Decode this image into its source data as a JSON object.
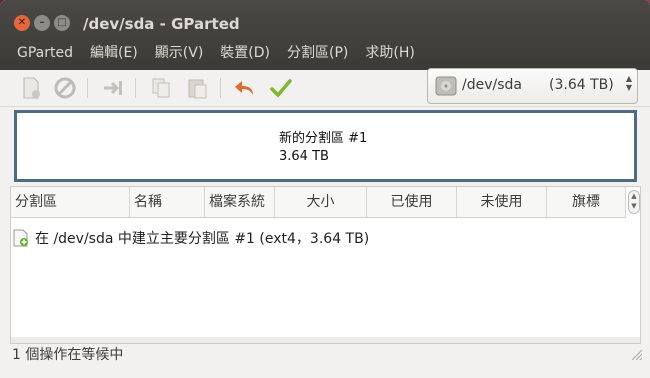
{
  "window": {
    "title": "/dev/sda - GParted"
  },
  "menu": [
    "GParted",
    "編輯(E)",
    "顯示(V)",
    "裝置(D)",
    "分割區(P)",
    "求助(H)"
  ],
  "toolbar": {
    "icons": [
      "new-partition-icon",
      "delete-icon",
      "resize-move-icon",
      "copy-icon",
      "paste-icon",
      "undo-icon",
      "apply-icon"
    ],
    "device_path": "/dev/sda",
    "device_size": "(3.64 TB)"
  },
  "map": {
    "label": "新的分割區 #1",
    "size": "3.64 TB"
  },
  "table": {
    "columns": [
      "分割區",
      "名稱",
      "檔案系統",
      "大小",
      "已使用",
      "未使用",
      "旗標"
    ]
  },
  "operations": [
    {
      "text": "在 /dev/sda 中建立主要分割區 #1 (ext4，3.64 TB)"
    }
  ],
  "status": "1 個操作在等候中",
  "colors": {
    "titlebar": "#3b3a36",
    "close": "#e4683e",
    "map_border": "#4f6a83",
    "apply": "#7fb82e",
    "undo": "#e06b2a"
  }
}
